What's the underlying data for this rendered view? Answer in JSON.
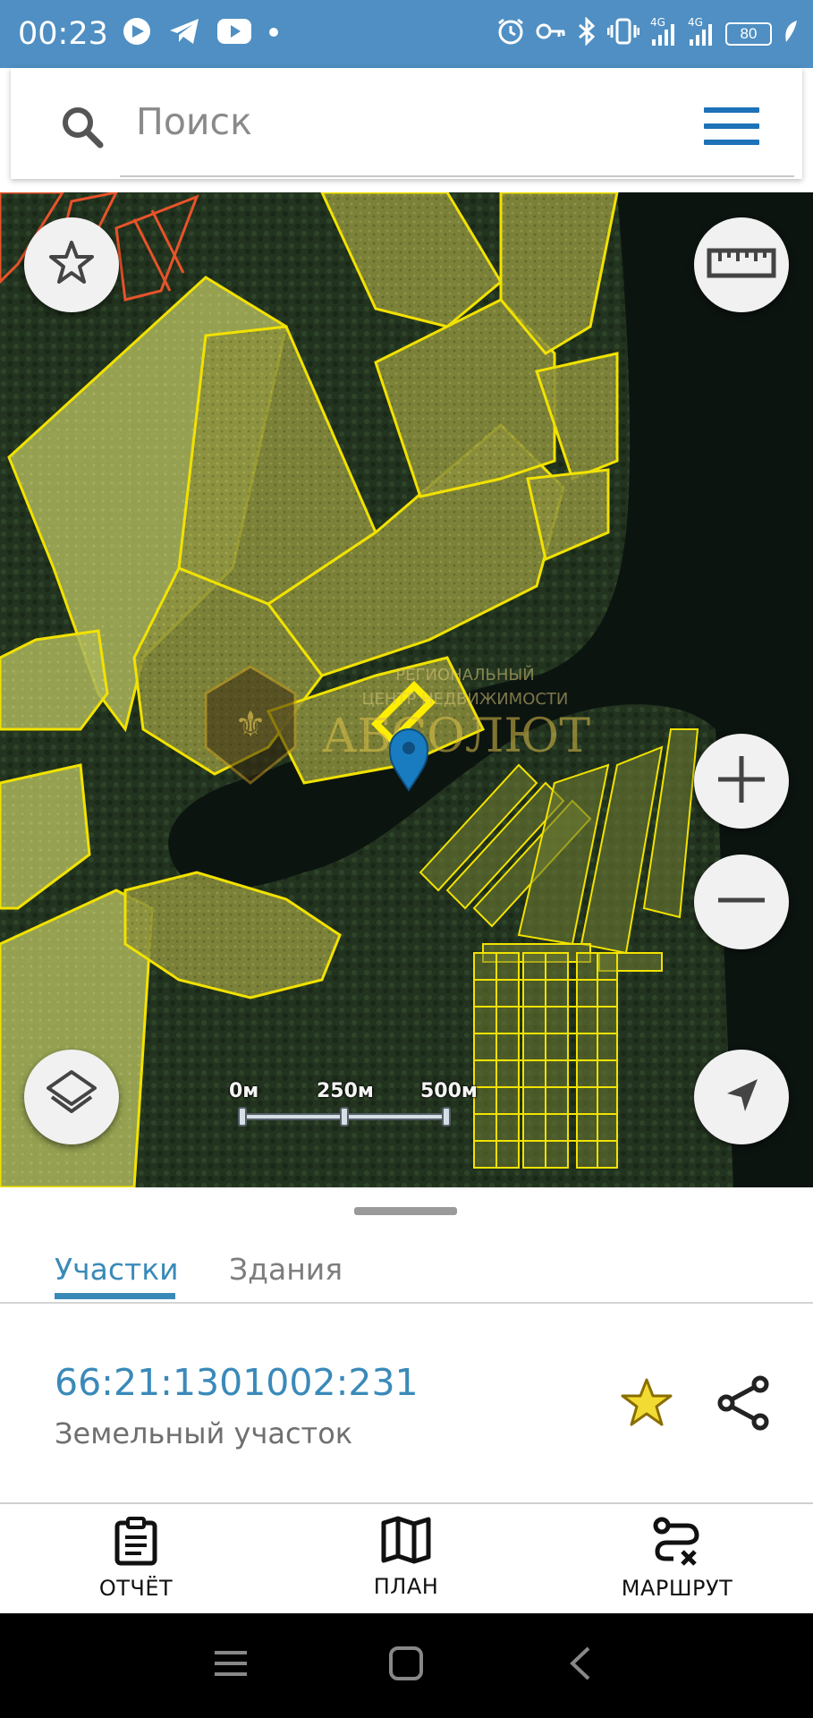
{
  "status_bar": {
    "time": "00:23",
    "battery": "80",
    "network_1": "4G",
    "network_2": "4G",
    "left_icons": [
      "app-notification-icon",
      "telegram-icon",
      "youtube-icon",
      "dot-icon"
    ],
    "right_icons": [
      "alarm-icon",
      "key-icon",
      "bluetooth-icon",
      "vibrate-icon",
      "signal-icon",
      "signal-icon",
      "battery-icon"
    ]
  },
  "search": {
    "placeholder": "Поиск"
  },
  "map": {
    "scale_labels": [
      "0м",
      "250м",
      "500м"
    ],
    "watermark_line1": "РЕГИОНАЛЬНЫЙ",
    "watermark_line2": "ЦЕНТР НЕДВИЖИМОСТИ",
    "watermark_brand": "АБСОЛЮТ",
    "buttons": [
      "star-icon",
      "ruler-icon",
      "zoom-in-icon",
      "zoom-out-icon",
      "layers-icon",
      "locate-icon"
    ]
  },
  "sheet": {
    "tabs": [
      {
        "label": "Участки",
        "active": true
      },
      {
        "label": "Здания",
        "active": false
      }
    ],
    "parcel": {
      "cadastral_number": "66:21:1301002:231",
      "type": "Земельный участок"
    }
  },
  "bottom_actions": [
    {
      "label": "ОТЧЁТ",
      "icon": "clipboard-icon"
    },
    {
      "label": "ПЛАН",
      "icon": "map-icon"
    },
    {
      "label": "МАРШРУТ",
      "icon": "route-icon"
    }
  ],
  "colors": {
    "status_bar": "#4f8fc3",
    "accent": "#3a8ab9",
    "menu_icon": "#1d72b8",
    "parcel_outline": "#f2e200",
    "favorite_star": "#e6c200"
  }
}
